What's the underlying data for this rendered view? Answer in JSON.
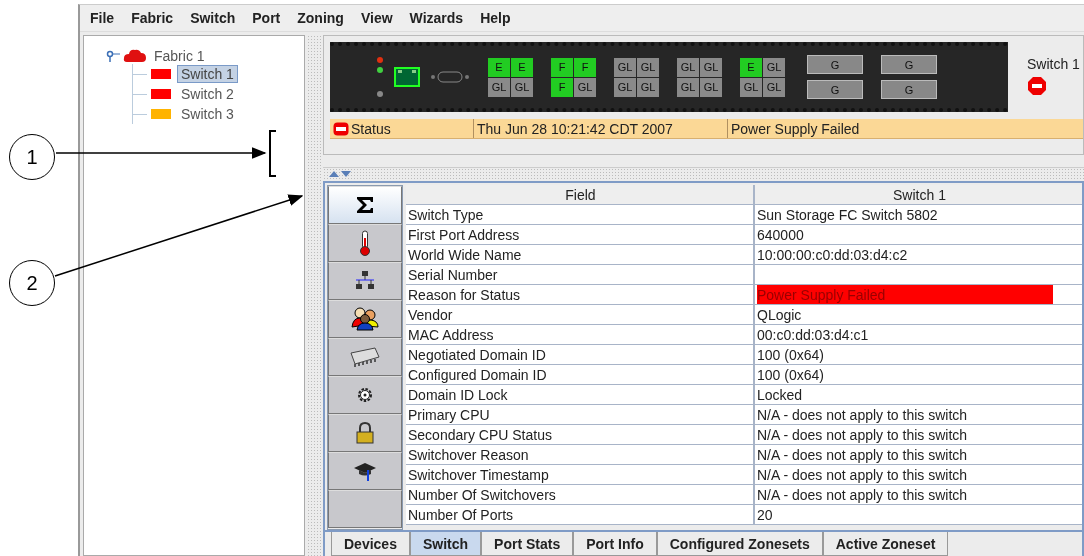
{
  "menu": [
    "File",
    "Fabric",
    "Switch",
    "Port",
    "Zoning",
    "View",
    "Wizards",
    "Help"
  ],
  "tree": {
    "label": "Fabric 1",
    "expanded": true,
    "children": [
      {
        "label": "Switch 1",
        "selected": true,
        "color": "#ff0000"
      },
      {
        "label": "Switch 2",
        "selected": false,
        "color": "#ff0000"
      },
      {
        "label": "Switch 3",
        "selected": false,
        "color": "#ffb300"
      }
    ]
  },
  "faceplate": {
    "name": "Switch 1",
    "port_blocks": [
      {
        "ports": [
          {
            "label": "E",
            "lit": true
          },
          {
            "label": "E",
            "lit": true
          },
          {
            "label": "GL",
            "lit": false
          },
          {
            "label": "GL",
            "lit": false
          }
        ]
      },
      {
        "ports": [
          {
            "label": "F",
            "lit": true
          },
          {
            "label": "F",
            "lit": true
          },
          {
            "label": "F",
            "lit": true
          },
          {
            "label": "GL",
            "lit": false
          }
        ]
      },
      {
        "ports": [
          {
            "label": "GL",
            "lit": false
          },
          {
            "label": "GL",
            "lit": false
          },
          {
            "label": "GL",
            "lit": false
          },
          {
            "label": "GL",
            "lit": false
          }
        ]
      },
      {
        "ports": [
          {
            "label": "GL",
            "lit": false
          },
          {
            "label": "GL",
            "lit": false
          },
          {
            "label": "GL",
            "lit": false
          },
          {
            "label": "GL",
            "lit": false
          }
        ]
      },
      {
        "ports": [
          {
            "label": "E",
            "lit": true
          },
          {
            "label": "GL",
            "lit": false
          },
          {
            "label": "GL",
            "lit": false
          },
          {
            "label": "GL",
            "lit": false
          }
        ]
      }
    ],
    "wide_ports": [
      "G",
      "G",
      "G",
      "G"
    ]
  },
  "status": {
    "label": "Status",
    "time": "Thu Jun 28 10:21:42 CDT 2007",
    "message": "Power Supply Failed"
  },
  "side_buttons": [
    {
      "selected": true
    },
    {
      "selected": false
    },
    {
      "selected": false
    },
    {
      "selected": false
    },
    {
      "selected": false
    },
    {
      "selected": false
    },
    {
      "selected": false
    },
    {
      "selected": false
    },
    {
      "selected": false
    }
  ],
  "table": {
    "columns": [
      "Field",
      "Switch 1"
    ],
    "rows": [
      {
        "field": "Switch Type",
        "value": "Sun  Storage  FC  Switch 5802",
        "alert": false
      },
      {
        "field": "First Port Address",
        "value": "640000",
        "alert": false
      },
      {
        "field": "World Wide Name",
        "value": "10:00:00:c0:dd:03:d4:c2",
        "alert": false
      },
      {
        "field": "Serial Number",
        "alert": false
      },
      {
        "field": "Reason for Status",
        "value": "Power Supply Failed",
        "alert": true
      },
      {
        "field": "Vendor",
        "value": "QLogic",
        "alert": false
      },
      {
        "field": "MAC Address",
        "value": "00:c0:dd:03:d4:c1",
        "alert": false
      },
      {
        "field": "Negotiated Domain ID",
        "value": "100 (0x64)",
        "alert": false
      },
      {
        "field": "Configured Domain ID",
        "value": "100 (0x64)",
        "alert": false
      },
      {
        "field": "Domain ID Lock",
        "value": "Locked",
        "alert": false
      },
      {
        "field": "Primary CPU",
        "value": "N/A - does not apply to this switch",
        "alert": false
      },
      {
        "field": "Secondary CPU Status",
        "value": "N/A - does not apply to this switch",
        "alert": false
      },
      {
        "field": "Switchover Reason",
        "value": "N/A - does not apply to this switch",
        "alert": false
      },
      {
        "field": "Switchover Timestamp",
        "value": "N/A - does not apply to this switch",
        "alert": false
      },
      {
        "field": "Number Of Switchovers",
        "value": "N/A - does not apply to this switch",
        "alert": false
      },
      {
        "field": "Number Of Ports",
        "value": "20",
        "alert": false
      }
    ]
  },
  "tabs": [
    {
      "label": "Devices",
      "selected": false
    },
    {
      "label": "Switch",
      "selected": true
    },
    {
      "label": "Port Stats",
      "selected": false
    },
    {
      "label": "Port Info",
      "selected": false
    },
    {
      "label": "Configured Zonesets",
      "selected": false
    },
    {
      "label": "Active Zoneset",
      "selected": false
    }
  ],
  "callouts": [
    "1",
    "2"
  ]
}
